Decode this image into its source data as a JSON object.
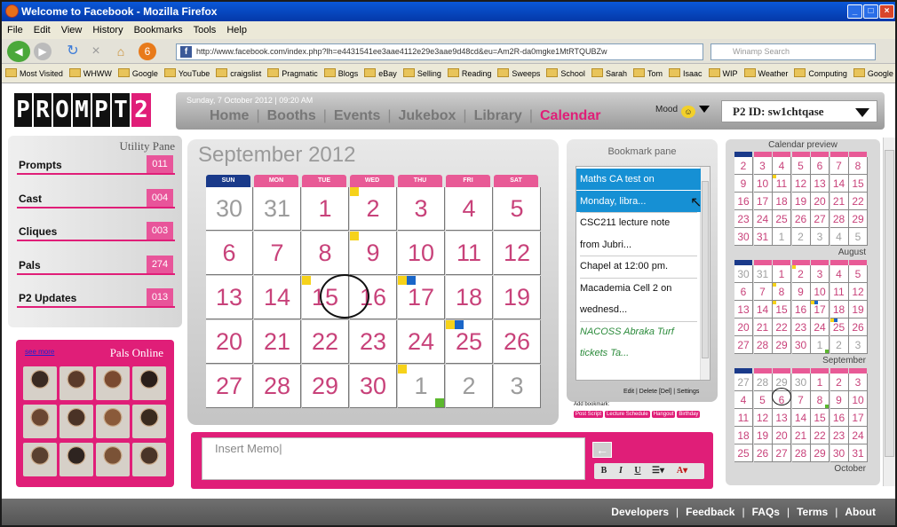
{
  "browser": {
    "window_title": "Welcome to Facebook - Mozilla Firefox",
    "menu": [
      "File",
      "Edit",
      "View",
      "History",
      "Bookmarks",
      "Tools",
      "Help"
    ],
    "url": "http://www.facebook.com/index.php?lh=e4431541ee3aae4112e29e3aae9d48cd&eu=Am2R-da0mgke1MtRTQUBZw",
    "search_placeholder": "Winamp Search",
    "bookmarks": [
      "Most Visited",
      "WHWW",
      "Google",
      "YouTube",
      "craigslist",
      "Pragmatic",
      "Blogs",
      "eBay",
      "Selling",
      "Reading",
      "Sweeps",
      "School",
      "Sarah",
      "Tom",
      "Isaac",
      "WIP",
      "Weather",
      "Computing",
      "Google Bookmark"
    ]
  },
  "header": {
    "logo_letters": [
      "P",
      "R",
      "O",
      "M",
      "P",
      "T",
      "2"
    ],
    "datetime": "Sunday, 7 October 2012 | 09:20 AM",
    "nav": [
      "Home",
      "Booths",
      "Events",
      "Jukebox",
      "Library",
      "Calendar"
    ],
    "active_nav": "Calendar",
    "mood_label": "Mood",
    "p2id": "P2 ID: sw1chtqase"
  },
  "utility": {
    "title": "Utility Pane",
    "items": [
      {
        "label": "Prompts",
        "count": "011"
      },
      {
        "label": "Cast",
        "count": "004"
      },
      {
        "label": "Cliques",
        "count": "003"
      },
      {
        "label": "Pals",
        "count": "274"
      },
      {
        "label": "P2 Updates",
        "count": "013"
      }
    ]
  },
  "pals": {
    "title": "Pals Online",
    "see_all": "see more"
  },
  "calendar": {
    "month_title": "September 2012",
    "days": [
      "SUN",
      "MON",
      "TUE",
      "WED",
      "THU",
      "FRI",
      "SAT"
    ],
    "weeks": [
      [
        "30",
        "31",
        "1",
        "2",
        "3",
        "4",
        "5"
      ],
      [
        "6",
        "7",
        "8",
        "9",
        "10",
        "11",
        "12"
      ],
      [
        "13",
        "14",
        "15",
        "16",
        "17",
        "18",
        "19"
      ],
      [
        "20",
        "21",
        "22",
        "23",
        "24",
        "25",
        "26"
      ],
      [
        "27",
        "28",
        "29",
        "30",
        "1",
        "2",
        "3"
      ]
    ],
    "today": "15"
  },
  "memo": {
    "placeholder": "Insert Memo|"
  },
  "bookmark_pane": {
    "title": "Bookmark pane",
    "items": [
      "Maths CA test on",
      "Monday, libra...",
      "CSC211 lecture note",
      "from Jubri...",
      "Chapel at 12:00 pm.",
      "Macademia Cell 2 on",
      "wednesd...",
      "NACOSS Abraka Turf",
      "tickets Ta..."
    ],
    "actions": "Edit | Delete [Del] | Settings",
    "add_label": "Add bookmark:",
    "add_buttons": [
      "Post Script",
      "Lecture Schedule",
      "Hangout",
      "Birthday"
    ]
  },
  "preview": {
    "title": "Calendar preview",
    "months": [
      {
        "label": "August",
        "weeks": [
          [
            "2",
            "3",
            "4",
            "5",
            "6",
            "7",
            "8"
          ],
          [
            "9",
            "10",
            "11",
            "12",
            "13",
            "14",
            "15"
          ],
          [
            "16",
            "17",
            "18",
            "19",
            "20",
            "21",
            "22"
          ],
          [
            "23",
            "24",
            "25",
            "26",
            "27",
            "28",
            "29"
          ],
          [
            "30",
            "31",
            "1",
            "2",
            "3",
            "4",
            "5"
          ]
        ]
      },
      {
        "label": "September",
        "weeks": [
          [
            "30",
            "31",
            "1",
            "2",
            "3",
            "4",
            "5"
          ],
          [
            "6",
            "7",
            "8",
            "9",
            "10",
            "11",
            "12"
          ],
          [
            "13",
            "14",
            "15",
            "16",
            "17",
            "18",
            "19"
          ],
          [
            "20",
            "21",
            "22",
            "23",
            "24",
            "25",
            "26"
          ],
          [
            "27",
            "28",
            "29",
            "30",
            "1",
            "2",
            "3"
          ]
        ]
      },
      {
        "label": "October",
        "weeks": [
          [
            "27",
            "28",
            "29",
            "30",
            "1",
            "2",
            "3"
          ],
          [
            "4",
            "5",
            "6",
            "7",
            "8",
            "9",
            "10"
          ],
          [
            "11",
            "12",
            "13",
            "14",
            "15",
            "16",
            "17"
          ],
          [
            "18",
            "19",
            "20",
            "21",
            "22",
            "23",
            "24"
          ],
          [
            "25",
            "26",
            "27",
            "28",
            "29",
            "30",
            "31"
          ]
        ]
      }
    ]
  },
  "footer": {
    "links": [
      "Developers",
      "Feedback",
      "FAQs",
      "Terms",
      "About"
    ]
  },
  "colors": {
    "brand_pink": "#e01e78",
    "sunday_blue": "#1a3a8a",
    "marker_yellow": "#f6d21a",
    "marker_blue": "#1a66c8",
    "marker_green": "#5cb82e"
  }
}
